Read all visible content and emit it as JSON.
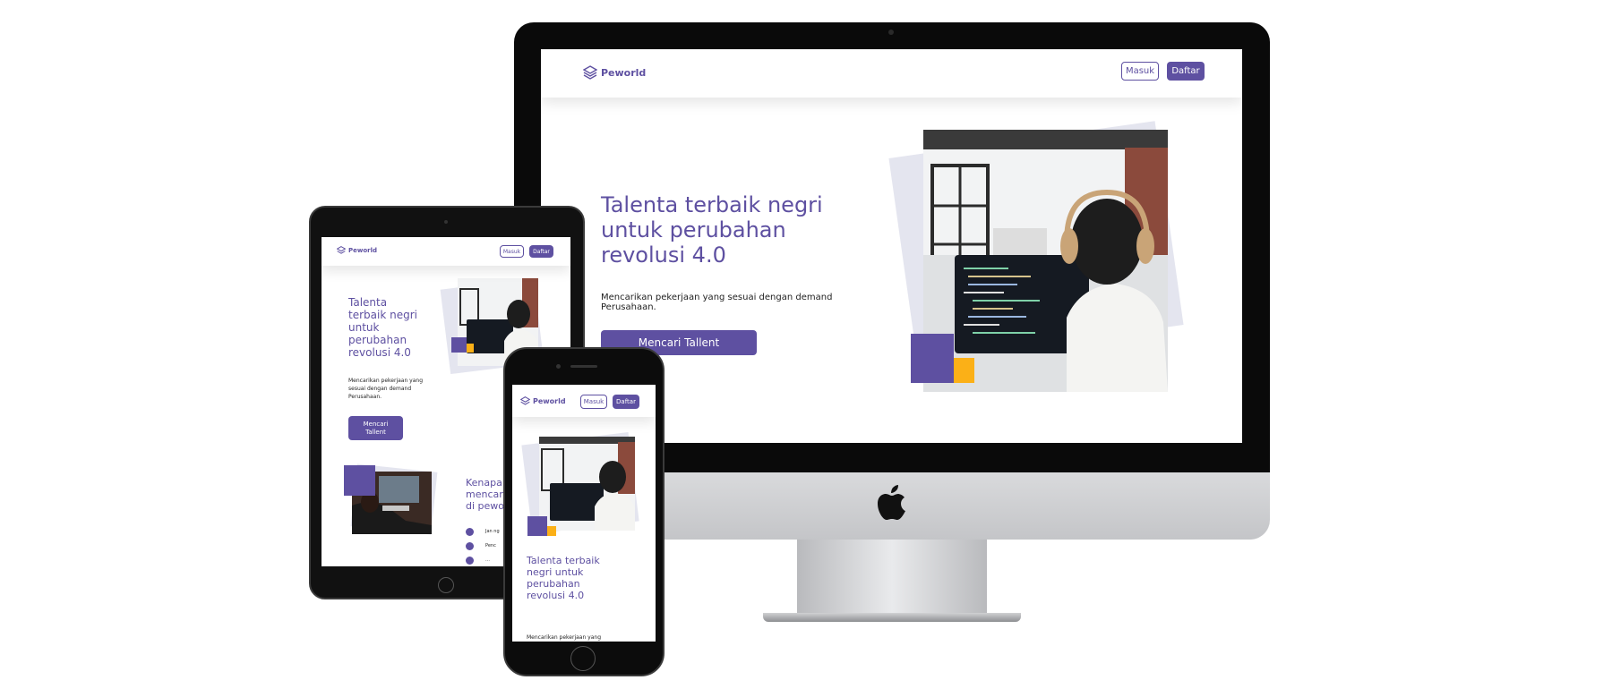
{
  "brand": {
    "name": "Peworld"
  },
  "nav": {
    "login": "Masuk",
    "register": "Daftar"
  },
  "hero": {
    "title": "Talenta terbaik negri untuk perubahan revolusi 4.0",
    "subtitle": "Mencarikan pekerjaan yang sesuai dengan demand Perusahaan.",
    "cta": "Mencari Tallent"
  },
  "tablet": {
    "title_lines": [
      "Talenta",
      "terbaik negri",
      "untuk",
      "perubahan",
      "revolusi 4.0"
    ],
    "subtitle_lines": [
      "Mencarikan pekerjaan yang",
      "sesuai dengan demand",
      "Perusahaan."
    ],
    "cta_lines": [
      "Mencari",
      "Tallent"
    ],
    "section_title_lines": [
      "Kenapa h",
      "mencari t",
      "di pewor"
    ],
    "list": [
      "Jan ng",
      "Penc",
      "…"
    ]
  },
  "phone": {
    "title_lines": [
      "Talenta terbaik",
      "negri untuk",
      "perubahan",
      "revolusi 4.0"
    ],
    "subtitle_partial": "Mencarikan pekerjaan yang"
  },
  "colors": {
    "primary": "#5e50a1",
    "accent": "#fbb017",
    "tilt": "#e4e5ef"
  },
  "icons": {
    "logo": "stacked-layers-icon",
    "check": "check-circle-icon",
    "device_logo": "apple-logo-icon"
  }
}
